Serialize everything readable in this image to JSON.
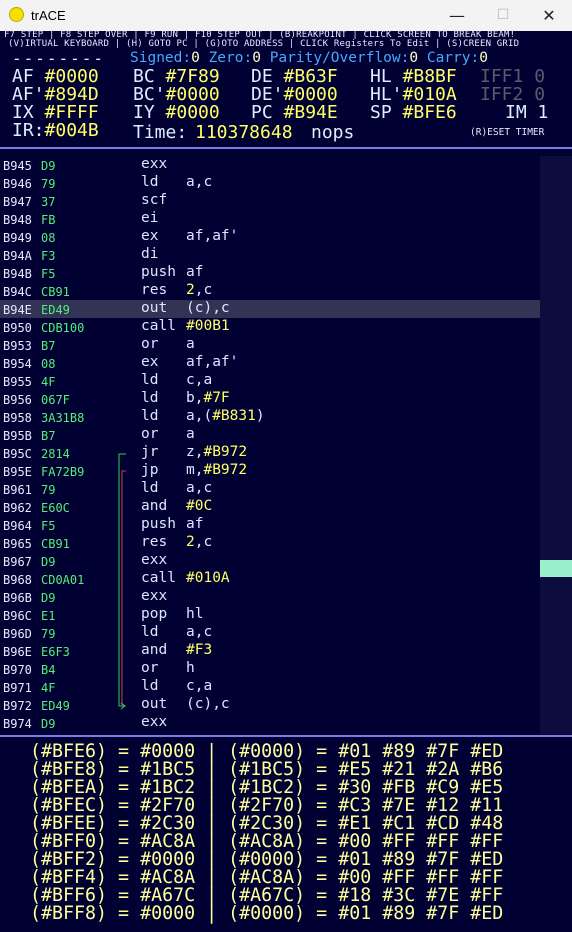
{
  "window": {
    "title": "trACE",
    "minimize": "—",
    "maximize": "☐",
    "close": "✕"
  },
  "help": {
    "line1": "F7 STEP | F8 STEP OVER | F9 RUN | F10 STEP OUT | (B)REAKPOINT | CLICK SCREEN TO BREAK BEAM!",
    "line2": "(V)IRTUAL KEYBOARD | (H) GOTO PC | (G)OTO ADDRESS | CLICK Registers To Edit | (S)CREEN GRID"
  },
  "flags": {
    "dashes": "--------",
    "signed_label": "Signed:",
    "signed": "0",
    "zero_label": " Zero:",
    "zero": "0",
    "parity_label": " Parity/Overflow:",
    "parity": "0",
    "carry_label": " Carry:",
    "carry": "0"
  },
  "registers": {
    "af": "#0000",
    "bc": "#7F89",
    "de": "#B63F",
    "hl": "#B8BF",
    "iff1": "0",
    "af2": "#894D",
    "bc2": "#0000",
    "de2": "#0000",
    "hl2": "#010A",
    "iff2": "0",
    "ix": "#FFFF",
    "iy": "#0000",
    "pc": "#B94E",
    "sp": "#BFE6",
    "im": "1",
    "ir": "#004B"
  },
  "time": {
    "label": "Time:",
    "value": "110378648",
    "unit": "nops",
    "reset": "(R)ESET TIMER"
  },
  "disassembly": [
    {
      "addr": "B945",
      "bytes": "D9",
      "mn": "exx",
      "op": ""
    },
    {
      "addr": "B946",
      "bytes": "79",
      "mn": "ld",
      "op": "a,c"
    },
    {
      "addr": "B947",
      "bytes": "37",
      "mn": "scf",
      "op": ""
    },
    {
      "addr": "B948",
      "bytes": "FB",
      "mn": "ei",
      "op": ""
    },
    {
      "addr": "B949",
      "bytes": "08",
      "mn": "ex",
      "op": "af,af'"
    },
    {
      "addr": "B94A",
      "bytes": "F3",
      "mn": "di",
      "op": ""
    },
    {
      "addr": "B94B",
      "bytes": "F5",
      "mn": "push",
      "op": "af"
    },
    {
      "addr": "B94C",
      "bytes": "CB91",
      "mn": "res",
      "op": "",
      "hex": "2",
      "post": ",c"
    },
    {
      "addr": "B94E",
      "bytes": "ED49",
      "mn": "out",
      "op": "(c),c",
      "selected": true
    },
    {
      "addr": "B950",
      "bytes": "CDB100",
      "mn": "call",
      "op": "",
      "hex": "#00B1"
    },
    {
      "addr": "B953",
      "bytes": "B7",
      "mn": "or",
      "op": "a"
    },
    {
      "addr": "B954",
      "bytes": "08",
      "mn": "ex",
      "op": "af,af'"
    },
    {
      "addr": "B955",
      "bytes": "4F",
      "mn": "ld",
      "op": "c,a"
    },
    {
      "addr": "B956",
      "bytes": "067F",
      "mn": "ld",
      "op": "b,",
      "hex": "#7F"
    },
    {
      "addr": "B958",
      "bytes": "3A31B8",
      "mn": "ld",
      "op": "a,(",
      "hex": "#B831",
      "post": ")"
    },
    {
      "addr": "B95B",
      "bytes": "B7",
      "mn": "or",
      "op": "a"
    },
    {
      "addr": "B95C",
      "bytes": "2814",
      "mn": "jr",
      "op": "z,",
      "hex": "#B972"
    },
    {
      "addr": "B95E",
      "bytes": "FA72B9",
      "mn": "jp",
      "op": "m,",
      "hex": "#B972"
    },
    {
      "addr": "B961",
      "bytes": "79",
      "mn": "ld",
      "op": "a,c"
    },
    {
      "addr": "B962",
      "bytes": "E60C",
      "mn": "and",
      "op": "",
      "hex": "#0C"
    },
    {
      "addr": "B964",
      "bytes": "F5",
      "mn": "push",
      "op": "af"
    },
    {
      "addr": "B965",
      "bytes": "CB91",
      "mn": "res",
      "op": "",
      "hex": "2",
      "post": ",c"
    },
    {
      "addr": "B967",
      "bytes": "D9",
      "mn": "exx",
      "op": ""
    },
    {
      "addr": "B968",
      "bytes": "CD0A01",
      "mn": "call",
      "op": "",
      "hex": "#010A"
    },
    {
      "addr": "B96B",
      "bytes": "D9",
      "mn": "exx",
      "op": ""
    },
    {
      "addr": "B96C",
      "bytes": "E1",
      "mn": "pop",
      "op": "hl"
    },
    {
      "addr": "B96D",
      "bytes": "79",
      "mn": "ld",
      "op": "a,c"
    },
    {
      "addr": "B96E",
      "bytes": "E6F3",
      "mn": "and",
      "op": "",
      "hex": "#F3"
    },
    {
      "addr": "B970",
      "bytes": "B4",
      "mn": "or",
      "op": "h"
    },
    {
      "addr": "B971",
      "bytes": "4F",
      "mn": "ld",
      "op": "c,a"
    },
    {
      "addr": "B972",
      "bytes": "ED49",
      "mn": "out",
      "op": "(c),c"
    },
    {
      "addr": "B974",
      "bytes": "D9",
      "mn": "exx",
      "op": ""
    }
  ],
  "memory": [
    {
      "a": "#BFE6",
      "w": "#0000",
      "b": "#01 #89 #7F #ED"
    },
    {
      "a": "#BFE8",
      "w": "#1BC5",
      "b": "#E5 #21 #2A #B6"
    },
    {
      "a": "#BFEA",
      "w": "#1BC2",
      "b": "#30 #FB #C9 #E5"
    },
    {
      "a": "#BFEC",
      "w": "#2F70",
      "b": "#C3 #7E #12 #11"
    },
    {
      "a": "#BFEE",
      "w": "#2C30",
      "b": "#E1 #C1 #CD #48"
    },
    {
      "a": "#BFF0",
      "w": "#AC8A",
      "b": "#00 #FF #FF #FF"
    },
    {
      "a": "#BFF2",
      "w": "#0000",
      "b": "#01 #89 #7F #ED"
    },
    {
      "a": "#BFF4",
      "w": "#AC8A",
      "b": "#00 #FF #FF #FF"
    },
    {
      "a": "#BFF6",
      "w": "#A67C",
      "b": "#18 #3C #7E #FF"
    },
    {
      "a": "#BFF8",
      "w": "#0000",
      "b": "#01 #89 #7F #ED"
    }
  ]
}
